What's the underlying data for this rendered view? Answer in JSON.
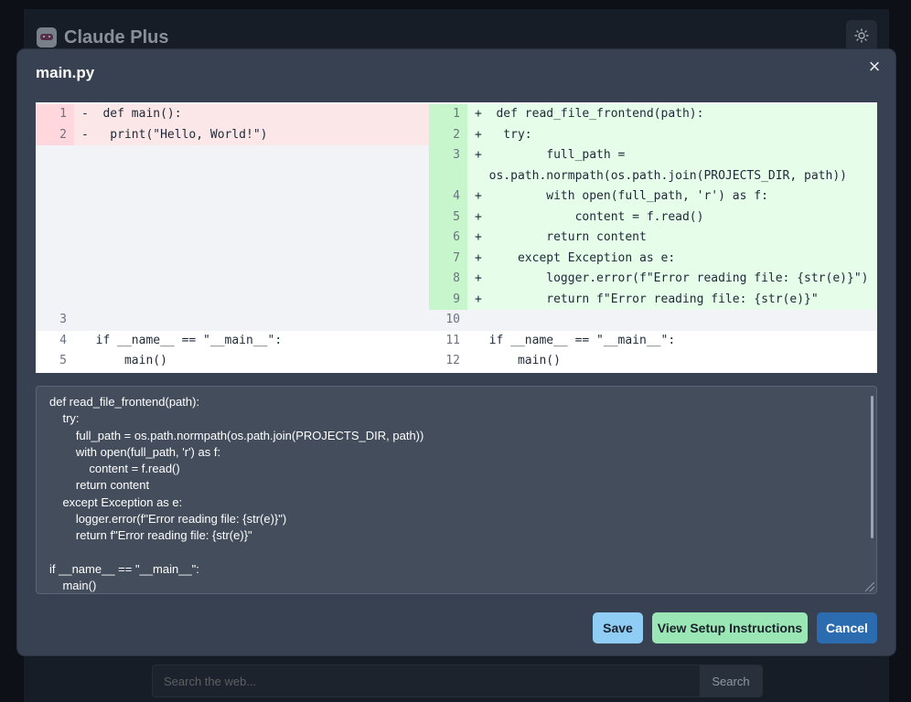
{
  "app": {
    "title": "Claude Plus",
    "search_placeholder": "Search the web...",
    "search_button": "Search"
  },
  "modal": {
    "title": "main.py",
    "close_label": "×"
  },
  "diff": {
    "left": [
      {
        "num": "1",
        "type": "del",
        "prefix": "-",
        "text": " def main():"
      },
      {
        "num": "2",
        "type": "del",
        "prefix": "-",
        "text": "  print(\"Hello, World!\")"
      },
      {
        "num": "3",
        "type": "blank",
        "prefix": "",
        "text": ""
      },
      {
        "num": "4",
        "type": "ctx",
        "prefix": "",
        "text": "  if __name__ == \"__main__\":"
      },
      {
        "num": "5",
        "type": "ctx",
        "prefix": "",
        "text": "      main()"
      }
    ],
    "right": [
      {
        "num": "1",
        "type": "add",
        "prefix": "+",
        "text": " def read_file_frontend(path):"
      },
      {
        "num": "2",
        "type": "add",
        "prefix": "+",
        "text": "  try:"
      },
      {
        "num": "3",
        "type": "add",
        "prefix": "+",
        "text": "        full_path =",
        "wrap": "os.path.normpath(os.path.join(PROJECTS_DIR, path))"
      },
      {
        "num": "4",
        "type": "add",
        "prefix": "+",
        "text": "        with open(full_path, 'r') as f:"
      },
      {
        "num": "5",
        "type": "add",
        "prefix": "+",
        "text": "            content = f.read()"
      },
      {
        "num": "6",
        "type": "add",
        "prefix": "+",
        "text": "        return content"
      },
      {
        "num": "7",
        "type": "add",
        "prefix": "+",
        "text": "    except Exception as e:"
      },
      {
        "num": "8",
        "type": "add",
        "prefix": "+",
        "text": "        logger.error(f\"Error reading file: {str(e)}\")"
      },
      {
        "num": "9",
        "type": "add",
        "prefix": "+",
        "text": "        return f\"Error reading file: {str(e)}\""
      },
      {
        "num": "10",
        "type": "blank",
        "prefix": "",
        "text": ""
      },
      {
        "num": "11",
        "type": "ctx",
        "prefix": "",
        "text": "  if __name__ == \"__main__\":"
      },
      {
        "num": "12",
        "type": "ctx",
        "prefix": "",
        "text": "      main()"
      }
    ]
  },
  "editor": {
    "content": "def read_file_frontend(path):\n    try:\n        full_path = os.path.normpath(os.path.join(PROJECTS_DIR, path))\n        with open(full_path, 'r') as f:\n            content = f.read()\n        return content\n    except Exception as e:\n        logger.error(f\"Error reading file: {str(e)}\")\n        return f\"Error reading file: {str(e)}\"\n\nif __name__ == \"__main__\":\n    main()"
  },
  "buttons": {
    "save": "Save",
    "setup": "View Setup Instructions",
    "cancel": "Cancel"
  },
  "colors": {
    "modal_bg": "#374151",
    "del_bg": "#fbe6e8",
    "add_bg": "#e6fdea",
    "save_bg": "#90cdf4",
    "setup_bg": "#9ae6b4",
    "cancel_bg": "#2b6cb0"
  }
}
